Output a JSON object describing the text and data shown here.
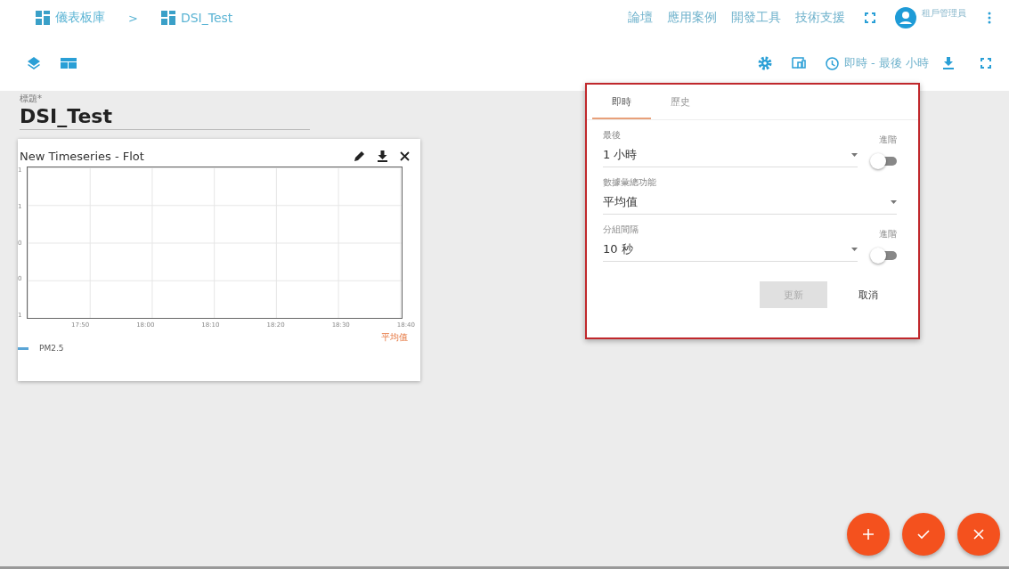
{
  "breadcrumb": [
    {
      "label": "儀表板庫"
    },
    {
      "label": "DSI_Test"
    }
  ],
  "breadcrumb_separator": ">",
  "nav": [
    "論壇",
    "應用案例",
    "開發工具",
    "技術支援"
  ],
  "user": {
    "role": "租戶管理員"
  },
  "toolbar": {
    "timewindow": "即時 - 最後 小時"
  },
  "title_field": {
    "label": "標題*",
    "value": "DSI_Test"
  },
  "widget": {
    "title": "New Timeseries - Flot",
    "y_ticks": [
      "1",
      "1",
      "0",
      "0",
      "1"
    ],
    "x_ticks": [
      "17:50",
      "18:00",
      "18:10",
      "18:20",
      "18:30",
      "18:40"
    ],
    "aggregation": "平均值",
    "legend": [
      {
        "name": "PM2.5",
        "color": "#5aa5d6"
      }
    ]
  },
  "timewindow_panel": {
    "tabs": [
      {
        "label": "即時",
        "selected": true
      },
      {
        "label": "歷史",
        "selected": false
      }
    ],
    "fields": [
      {
        "label": "最後",
        "value": "1 小時",
        "toggle_label": "進階",
        "on": false
      },
      {
        "label": "數據彙總功能",
        "value": "平均值"
      },
      {
        "label": "分組間隔",
        "value": "10 秒",
        "toggle_label": "進階",
        "on": false
      }
    ],
    "buttons": [
      {
        "label": "更新",
        "disabled": true
      },
      {
        "label": "取消",
        "disabled": false
      }
    ]
  },
  "fab_buttons": [
    {
      "kind": "add"
    },
    {
      "kind": "apply"
    },
    {
      "kind": "close"
    }
  ]
}
